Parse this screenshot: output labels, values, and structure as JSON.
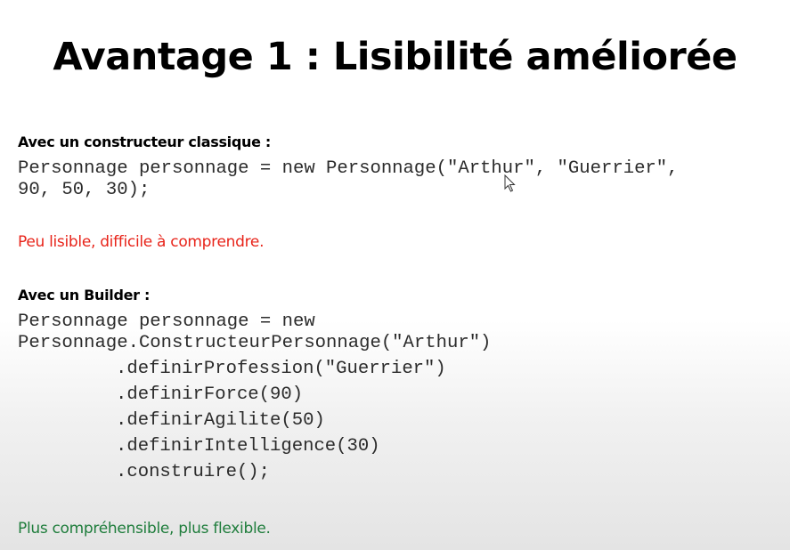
{
  "slide": {
    "title": "Avantage 1 : Lisibilité améliorée",
    "classic": {
      "label": "Avec un constructeur classique :",
      "code_lines": [
        "Personnage personnage = new Personnage(\"Arthur\", \"Guerrier\",",
        "90, 50, 30);"
      ],
      "note": "Peu lisible, difficile à comprendre.",
      "note_color": "#e8241a"
    },
    "builder": {
      "label": "Avec un Builder :",
      "code_lines": [
        "Personnage personnage = new",
        "Personnage.ConstructeurPersonnage(\"Arthur\")"
      ],
      "chain_lines": [
        ".definirProfession(\"Guerrier\")",
        ".definirForce(90)",
        ".definirAgilite(50)",
        ".definirIntelligence(30)",
        ".construire();"
      ],
      "note": "Plus compréhensible, plus flexible.",
      "note_color": "#1f7d3c"
    },
    "cursor_icon": "mouse-pointer-icon"
  }
}
